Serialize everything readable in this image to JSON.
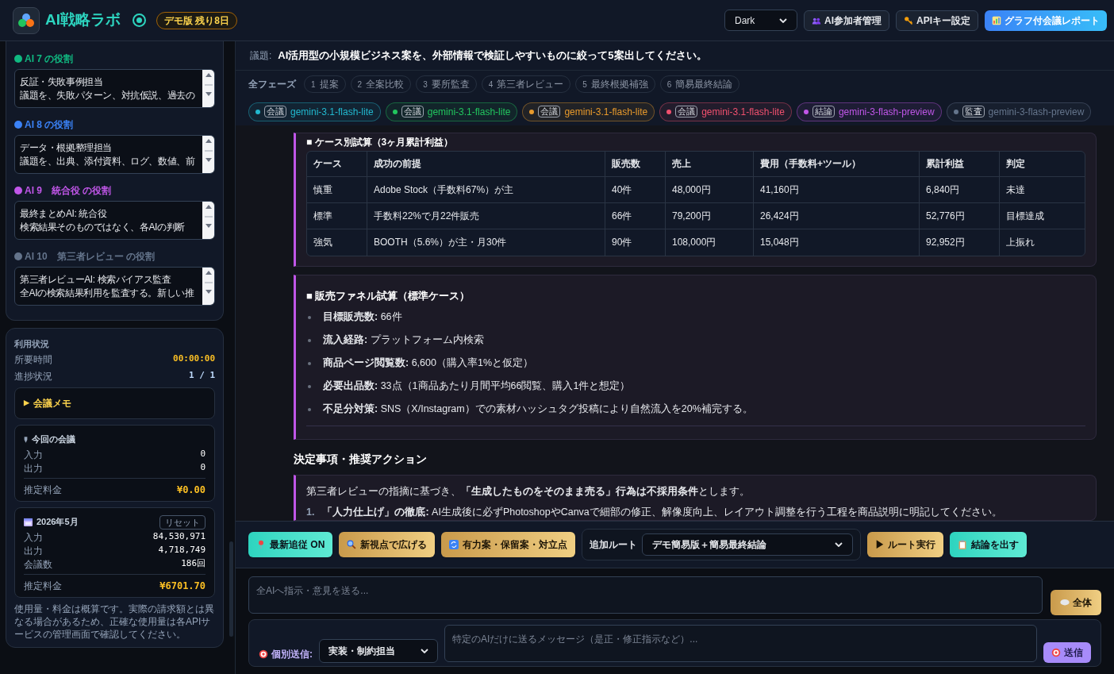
{
  "header": {
    "app_title": "AI戦略ラボ",
    "demo_badge": "デモ版 残り8日",
    "theme_select": "Dark",
    "buttons": [
      {
        "label": "AI参加者管理",
        "kind": "people",
        "primary": false
      },
      {
        "label": "APIキー設定",
        "kind": "key",
        "primary": false
      },
      {
        "label": "グラフ付会議レポート",
        "kind": "chart",
        "primary": true
      }
    ]
  },
  "sidebar": {
    "roles": [
      {
        "label": "AI 7 の役割",
        "color": "#10b981",
        "lines": [
          "反証・失敗事例担当",
          "議題を、失敗パターン、対抗仮説、過去の"
        ]
      },
      {
        "label": "AI 8 の役割",
        "color": "#3b82f6",
        "lines": [
          "データ・根拠整理担当",
          "議題を、出典、添付資料、ログ、数値、前"
        ]
      },
      {
        "label": "AI 9　統合役 の役割",
        "color": "#c056e8",
        "lines": [
          "最終まとめAI: 統合役",
          "検索結果そのものではなく、各AIの判断"
        ]
      },
      {
        "label": "AI 10　第三者レビュー の役割",
        "color": "#64748b",
        "lines": [
          "第三者レビューAI: 検索バイアス監査",
          "全AIの検索結果利用を監査する。新しい推"
        ]
      }
    ],
    "usage": {
      "title": "利用状況",
      "rows": [
        {
          "label": "所要時間",
          "value": "00:00:00"
        },
        {
          "label": "進捗状況",
          "value": "1 / 1"
        }
      ],
      "memo": {
        "marker": "▶",
        "label": "会議メモ"
      },
      "current": {
        "title": "今回の会議",
        "rows": [
          {
            "label": "入力",
            "value": "0"
          },
          {
            "label": "出力",
            "value": "0"
          }
        ],
        "fee_label": "推定料金",
        "fee": "¥0.00"
      },
      "month": {
        "title": "2026年5月",
        "reset": "リセット",
        "rows": [
          {
            "label": "入力",
            "value": "84,530,971"
          },
          {
            "label": "出力",
            "value": "4,718,749"
          },
          {
            "label": "会議数",
            "value": "186回"
          }
        ],
        "fee_label": "推定料金",
        "fee": "¥6701.70"
      },
      "note": "使用量・料金は概算です。実際の請求額とは異なる場合があるため、正確な使用量は各APIサービスの管理画面で確認してください。"
    }
  },
  "topic": {
    "label": "議題:",
    "text": "AI活用型の小規模ビジネス案を、外部情報で検証しやすいものに絞って5案出してください。"
  },
  "phases": {
    "label": "全フェーズ",
    "items": [
      {
        "number": "1",
        "name": "提案"
      },
      {
        "number": "2",
        "name": "全案比較"
      },
      {
        "number": "3",
        "name": "要所監査"
      },
      {
        "number": "4",
        "name": "第三者レビュー"
      },
      {
        "number": "5",
        "name": "最終根拠補強"
      },
      {
        "number": "6",
        "name": "簡易最終結論"
      }
    ]
  },
  "participants": [
    {
      "color": "#22b8cf",
      "tag": "会議",
      "model": "gemini-3.1-flash-lite"
    },
    {
      "color": "#22c55e",
      "tag": "会議",
      "model": "gemini-3.1-flash-lite"
    },
    {
      "color": "#e89a2c",
      "tag": "会議",
      "model": "gemini-3.1-flash-lite"
    },
    {
      "color": "#f0506e",
      "tag": "会議",
      "model": "gemini-3.1-flash-lite"
    },
    {
      "color": "#c056e8",
      "tag": "結論",
      "model": "gemini-3-flash-preview"
    },
    {
      "color": "#64748b",
      "tag": "監査",
      "model": "gemini-3-flash-preview"
    }
  ],
  "content": {
    "table_card": {
      "heading": "■ ケース別試算（3ヶ月累計利益）",
      "columns": [
        "ケース",
        "成功の前提",
        "販売数",
        "売上",
        "費用（手数料+ツール）",
        "累計利益",
        "判定"
      ],
      "rows": [
        [
          "慎重",
          "Adobe Stock（手数料67%）が主",
          "40件",
          "48,000円",
          "41,160円",
          "6,840円",
          "未達"
        ],
        [
          "標準",
          "手数料22%で月22件販売",
          "66件",
          "79,200円",
          "26,424円",
          "52,776円",
          "目標達成"
        ],
        [
          "強気",
          "BOOTH（5.6%）が主・月30件",
          "90件",
          "108,000円",
          "15,048円",
          "92,952円",
          "上振れ"
        ]
      ]
    },
    "funnel_card": {
      "heading": "■ 販売ファネル試算（標準ケース）",
      "items": [
        "**目標販売数:** 66件",
        "**流入経路:** プラットフォーム内検索",
        "**商品ページ閲覧数:** 6,600（購入率1%と仮定）",
        "**必要出品数:** 33点（1商品あたり月間平均66閲覧、購入1件と想定）",
        "**不足分対策:** SNS（X/Instagram）での素材ハッシュタグ投稿により自然流入を20%補完する。"
      ]
    },
    "decision_heading": "決定事項・推奨アクション",
    "decision_card": {
      "paragraph": "第三者レビューの指摘に基づき、**「生成したものをそのまま売る」行為は不採用条件**とします。",
      "items": [
        {
          "number": "1.",
          "text": "**「人力仕上げ」の徹底:** AI生成後に必ずPhotoshopやCanvaで細部の修正、解像度向上、レイアウト調整を行う工程を商品説明に明記してください。"
        }
      ]
    }
  },
  "actions": {
    "buttons": [
      {
        "label": "最新追従 ON",
        "kind": "pin"
      },
      {
        "label": "新視点で広げる",
        "kind": "search"
      },
      {
        "label": "有力案・保留案・対立点",
        "kind": "cycle"
      }
    ],
    "route_label": "追加ルート",
    "route_select": "デモ簡易版＋簡易最終結論",
    "after": [
      {
        "label": "▶ ルート実行",
        "kind": "play"
      },
      {
        "label": "結論を出す",
        "kind": "clipboard"
      }
    ]
  },
  "composer": {
    "all_placeholder": "全AIへ指示・意見を送る...",
    "all_button": "全体",
    "individual_label": "個別送信:",
    "individual_select": "実装・制約担当",
    "individual_placeholder": "特定のAIだけに送るメッセージ（是正・修正指示など）...",
    "send_button": "送信"
  }
}
